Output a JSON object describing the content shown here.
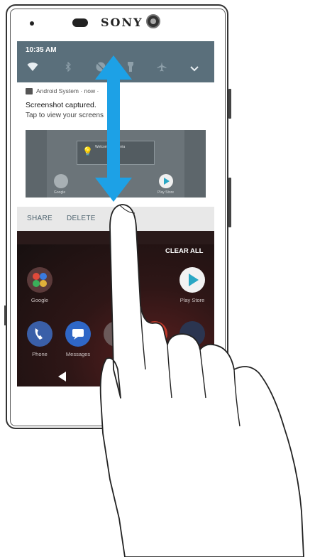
{
  "device": {
    "brand": "SONY"
  },
  "status_bar": {
    "time": "10:35 AM"
  },
  "quick_settings": {
    "icons": [
      "wifi-icon",
      "bluetooth-icon",
      "do-not-disturb-icon",
      "flashlight-icon",
      "airplane-mode-icon",
      "expand-chevron-icon"
    ]
  },
  "notification": {
    "app": "Android System · now ·",
    "title": "Screenshot captured.",
    "text": "Tap to view your screens",
    "preview": {
      "card_text": "Welcome to Xperia",
      "icon_1_label": "Google",
      "icon_2_label": "Play Store"
    },
    "actions": {
      "share": "SHARE",
      "delete": "DELETE"
    }
  },
  "home": {
    "clear_all": "CLEAR ALL",
    "apps": {
      "google": "Google",
      "play_store": "Play Store",
      "phone": "Phone",
      "messages": "Messages"
    }
  },
  "colors": {
    "quick_settings_bg": "#5a6f7b",
    "arrow": "#1da1e6",
    "action_text": "#4f6470"
  }
}
